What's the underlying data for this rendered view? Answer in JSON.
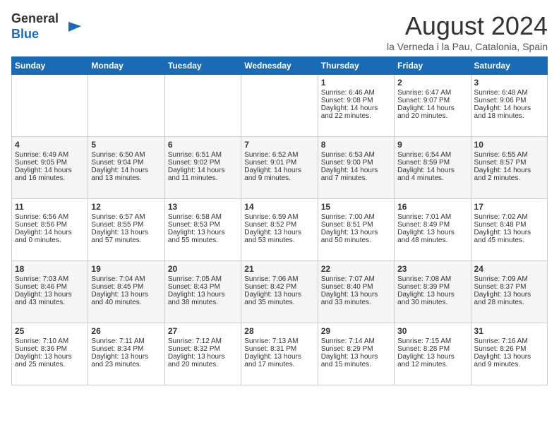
{
  "header": {
    "logo_general": "General",
    "logo_blue": "Blue",
    "title": "August 2024",
    "location": "la Verneda i la Pau, Catalonia, Spain"
  },
  "days_of_week": [
    "Sunday",
    "Monday",
    "Tuesday",
    "Wednesday",
    "Thursday",
    "Friday",
    "Saturday"
  ],
  "weeks": [
    [
      {
        "day": "",
        "text": ""
      },
      {
        "day": "",
        "text": ""
      },
      {
        "day": "",
        "text": ""
      },
      {
        "day": "",
        "text": ""
      },
      {
        "day": "1",
        "text": "Sunrise: 6:46 AM\nSunset: 9:08 PM\nDaylight: 14 hours\nand 22 minutes."
      },
      {
        "day": "2",
        "text": "Sunrise: 6:47 AM\nSunset: 9:07 PM\nDaylight: 14 hours\nand 20 minutes."
      },
      {
        "day": "3",
        "text": "Sunrise: 6:48 AM\nSunset: 9:06 PM\nDaylight: 14 hours\nand 18 minutes."
      }
    ],
    [
      {
        "day": "4",
        "text": "Sunrise: 6:49 AM\nSunset: 9:05 PM\nDaylight: 14 hours\nand 16 minutes."
      },
      {
        "day": "5",
        "text": "Sunrise: 6:50 AM\nSunset: 9:04 PM\nDaylight: 14 hours\nand 13 minutes."
      },
      {
        "day": "6",
        "text": "Sunrise: 6:51 AM\nSunset: 9:02 PM\nDaylight: 14 hours\nand 11 minutes."
      },
      {
        "day": "7",
        "text": "Sunrise: 6:52 AM\nSunset: 9:01 PM\nDaylight: 14 hours\nand 9 minutes."
      },
      {
        "day": "8",
        "text": "Sunrise: 6:53 AM\nSunset: 9:00 PM\nDaylight: 14 hours\nand 7 minutes."
      },
      {
        "day": "9",
        "text": "Sunrise: 6:54 AM\nSunset: 8:59 PM\nDaylight: 14 hours\nand 4 minutes."
      },
      {
        "day": "10",
        "text": "Sunrise: 6:55 AM\nSunset: 8:57 PM\nDaylight: 14 hours\nand 2 minutes."
      }
    ],
    [
      {
        "day": "11",
        "text": "Sunrise: 6:56 AM\nSunset: 8:56 PM\nDaylight: 14 hours\nand 0 minutes."
      },
      {
        "day": "12",
        "text": "Sunrise: 6:57 AM\nSunset: 8:55 PM\nDaylight: 13 hours\nand 57 minutes."
      },
      {
        "day": "13",
        "text": "Sunrise: 6:58 AM\nSunset: 8:53 PM\nDaylight: 13 hours\nand 55 minutes."
      },
      {
        "day": "14",
        "text": "Sunrise: 6:59 AM\nSunset: 8:52 PM\nDaylight: 13 hours\nand 53 minutes."
      },
      {
        "day": "15",
        "text": "Sunrise: 7:00 AM\nSunset: 8:51 PM\nDaylight: 13 hours\nand 50 minutes."
      },
      {
        "day": "16",
        "text": "Sunrise: 7:01 AM\nSunset: 8:49 PM\nDaylight: 13 hours\nand 48 minutes."
      },
      {
        "day": "17",
        "text": "Sunrise: 7:02 AM\nSunset: 8:48 PM\nDaylight: 13 hours\nand 45 minutes."
      }
    ],
    [
      {
        "day": "18",
        "text": "Sunrise: 7:03 AM\nSunset: 8:46 PM\nDaylight: 13 hours\nand 43 minutes."
      },
      {
        "day": "19",
        "text": "Sunrise: 7:04 AM\nSunset: 8:45 PM\nDaylight: 13 hours\nand 40 minutes."
      },
      {
        "day": "20",
        "text": "Sunrise: 7:05 AM\nSunset: 8:43 PM\nDaylight: 13 hours\nand 38 minutes."
      },
      {
        "day": "21",
        "text": "Sunrise: 7:06 AM\nSunset: 8:42 PM\nDaylight: 13 hours\nand 35 minutes."
      },
      {
        "day": "22",
        "text": "Sunrise: 7:07 AM\nSunset: 8:40 PM\nDaylight: 13 hours\nand 33 minutes."
      },
      {
        "day": "23",
        "text": "Sunrise: 7:08 AM\nSunset: 8:39 PM\nDaylight: 13 hours\nand 30 minutes."
      },
      {
        "day": "24",
        "text": "Sunrise: 7:09 AM\nSunset: 8:37 PM\nDaylight: 13 hours\nand 28 minutes."
      }
    ],
    [
      {
        "day": "25",
        "text": "Sunrise: 7:10 AM\nSunset: 8:36 PM\nDaylight: 13 hours\nand 25 minutes."
      },
      {
        "day": "26",
        "text": "Sunrise: 7:11 AM\nSunset: 8:34 PM\nDaylight: 13 hours\nand 23 minutes."
      },
      {
        "day": "27",
        "text": "Sunrise: 7:12 AM\nSunset: 8:32 PM\nDaylight: 13 hours\nand 20 minutes."
      },
      {
        "day": "28",
        "text": "Sunrise: 7:13 AM\nSunset: 8:31 PM\nDaylight: 13 hours\nand 17 minutes."
      },
      {
        "day": "29",
        "text": "Sunrise: 7:14 AM\nSunset: 8:29 PM\nDaylight: 13 hours\nand 15 minutes."
      },
      {
        "day": "30",
        "text": "Sunrise: 7:15 AM\nSunset: 8:28 PM\nDaylight: 13 hours\nand 12 minutes."
      },
      {
        "day": "31",
        "text": "Sunrise: 7:16 AM\nSunset: 8:26 PM\nDaylight: 13 hours\nand 9 minutes."
      }
    ]
  ]
}
